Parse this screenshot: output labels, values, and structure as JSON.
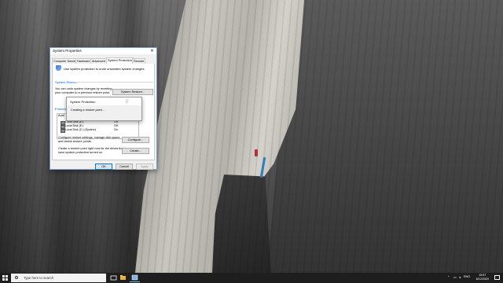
{
  "window": {
    "title": "System Properties",
    "close_glyph": "✕",
    "tabs": [
      "Computer Name",
      "Hardware",
      "Advanced",
      "System Protection",
      "Remote"
    ],
    "active_tab": "System Protection",
    "intro": "Use system protection to undo unwanted system changes.",
    "system_restore": {
      "heading": "System Restore",
      "text_line1": "You can undo system changes by reverting",
      "text_line2": "your computer to a previous restore point.",
      "button": "System Restore..."
    },
    "protection": {
      "heading": "Protection Settings",
      "header_available": "Avail",
      "drives": [
        {
          "name": "Local Disk (E:)",
          "protection": "Off"
        },
        {
          "name": "Local Disk (E:)",
          "protection": "Off"
        },
        {
          "name": "Local Disk (C:) (System)",
          "protection": "On"
        }
      ],
      "configure_text_line1": "Configure restore settings, manage disk space,",
      "configure_text_line2": "and delete restore points.",
      "configure_button": "Configure...",
      "create_text_line1": "Create a restore point right now for the drives that",
      "create_text_line2": "have system protection turned on.",
      "create_button": "Create..."
    },
    "buttons": {
      "ok": "OK",
      "cancel": "Cancel",
      "apply": "Apply"
    }
  },
  "popup": {
    "title": "System Protection",
    "message": "Creating a restore point..."
  },
  "taskbar": {
    "search_placeholder": "Type here to search",
    "language": "ENG",
    "time": "15:57",
    "date": "8/12/2020"
  }
}
